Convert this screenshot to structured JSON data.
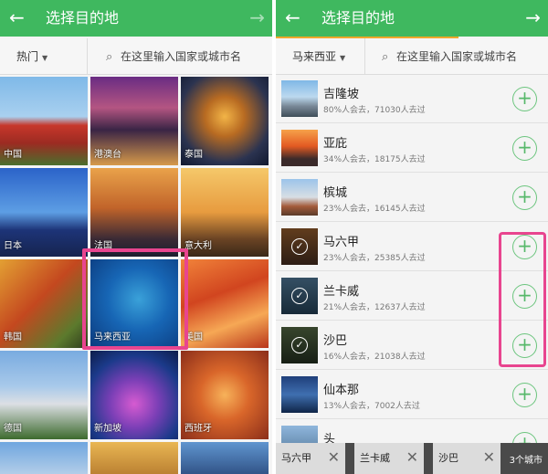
{
  "left": {
    "header": {
      "back_icon": "←",
      "title": "选择目的地",
      "forward_icon": "→"
    },
    "dropdown": {
      "label": "热门"
    },
    "search": {
      "placeholder": "在这里输入国家或城市名"
    },
    "tiles": [
      {
        "label": "中国"
      },
      {
        "label": "港澳台"
      },
      {
        "label": "泰国"
      },
      {
        "label": "日本"
      },
      {
        "label": "法国"
      },
      {
        "label": "意大利"
      },
      {
        "label": "韩国"
      },
      {
        "label": "马来西亚"
      },
      {
        "label": "美国"
      },
      {
        "label": "德国"
      },
      {
        "label": "新加坡"
      },
      {
        "label": "西班牙"
      }
    ]
  },
  "right": {
    "header": {
      "back_icon": "←",
      "title": "选择目的地",
      "forward_icon": "→"
    },
    "dropdown": {
      "label": "马来西亚"
    },
    "search": {
      "placeholder": "在这里输入国家或城市名"
    },
    "cities": [
      {
        "name": "吉隆坡",
        "stats": "80%人会去，71030人去过",
        "selected": false
      },
      {
        "name": "亚庇",
        "stats": "34%人会去，18175人去过",
        "selected": false
      },
      {
        "name": "槟城",
        "stats": "23%人会去，16145人去过",
        "selected": false
      },
      {
        "name": "马六甲",
        "stats": "23%人会去，25385人去过",
        "selected": true
      },
      {
        "name": "兰卡威",
        "stats": "21%人会去，12637人去过",
        "selected": true
      },
      {
        "name": "沙巴",
        "stats": "16%人会去，21038人去过",
        "selected": true
      },
      {
        "name": "仙本那",
        "stats": "13%人会去，7002人去过",
        "selected": false
      },
      {
        "name": "头",
        "stats": "",
        "selected": false
      }
    ],
    "bottom": {
      "chips": [
        {
          "label": "马六甲"
        },
        {
          "label": "兰卡威"
        },
        {
          "label": "沙巴"
        }
      ],
      "remove_icon": "✕",
      "count": "3个城市"
    }
  },
  "colors": {
    "header": "#3fb85f",
    "accent": "#f0a72c",
    "highlight": "#e8458f",
    "add": "#6cc57e"
  }
}
